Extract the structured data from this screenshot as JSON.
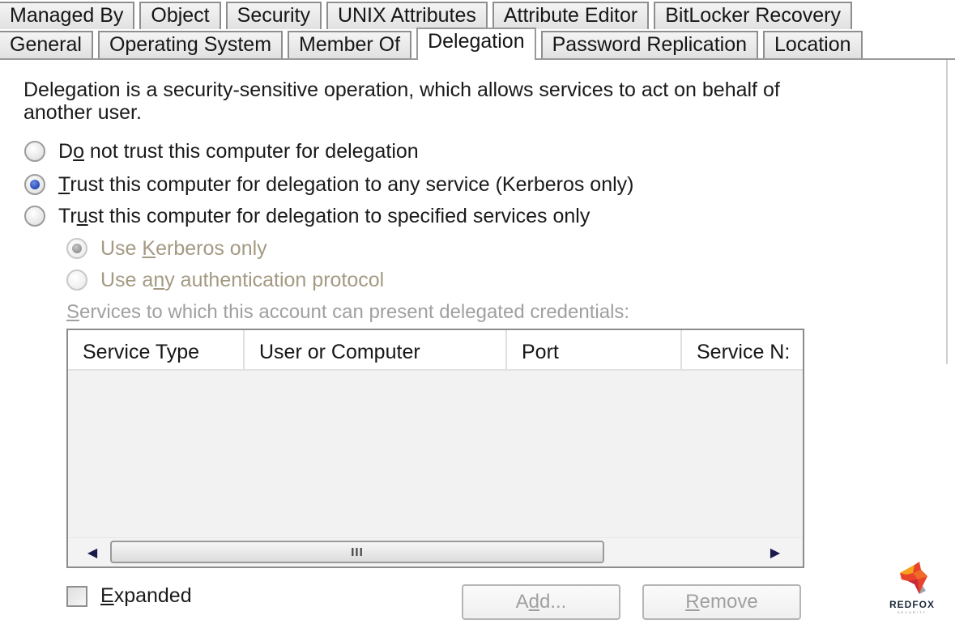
{
  "tabs": {
    "row1": [
      {
        "label": "Managed By"
      },
      {
        "label": "Object"
      },
      {
        "label": "Security"
      },
      {
        "label": "UNIX Attributes"
      },
      {
        "label": "Attribute Editor"
      },
      {
        "label": "BitLocker Recovery"
      }
    ],
    "row2": [
      {
        "label": "General"
      },
      {
        "label": "Operating System"
      },
      {
        "label": "Member Of"
      },
      {
        "label": "Delegation",
        "active": true
      },
      {
        "label": "Password Replication"
      },
      {
        "label": "Location"
      }
    ]
  },
  "delegation": {
    "intro": "Delegation is a security-sensitive operation, which allows services to act on behalf of another user.",
    "options": [
      {
        "pre": "D",
        "key": "o",
        "post": " not trust this computer for delegation",
        "checked": false,
        "enabled": true
      },
      {
        "pre": "",
        "key": "T",
        "post": "rust this computer for delegation to any service (Kerberos only)",
        "checked": true,
        "enabled": true
      },
      {
        "pre": "Tr",
        "key": "u",
        "post": "st this computer for delegation to specified services only",
        "checked": false,
        "enabled": true
      }
    ],
    "sub_options": [
      {
        "pre": "Use ",
        "key": "K",
        "post": "erberos only",
        "checked": true,
        "enabled": false
      },
      {
        "pre": "Use a",
        "key": "n",
        "post": "y authentication protocol",
        "checked": false,
        "enabled": false
      }
    ],
    "services_label": {
      "key": "S",
      "post": "ervices to which this account can present delegated credentials:"
    },
    "columns": [
      "Service Type",
      "User or Computer",
      "Port",
      "Service N:"
    ],
    "rows": [],
    "scroll_grip": "III",
    "expanded": {
      "key": "E",
      "post": "xpanded",
      "checked": false
    },
    "add_button": {
      "pre": "A",
      "key": "d",
      "post": "d..."
    },
    "remove_button": {
      "pre": "",
      "key": "R",
      "post": "emove"
    }
  },
  "logo": {
    "name": "REDFOX",
    "tagline": "SECURITY"
  }
}
